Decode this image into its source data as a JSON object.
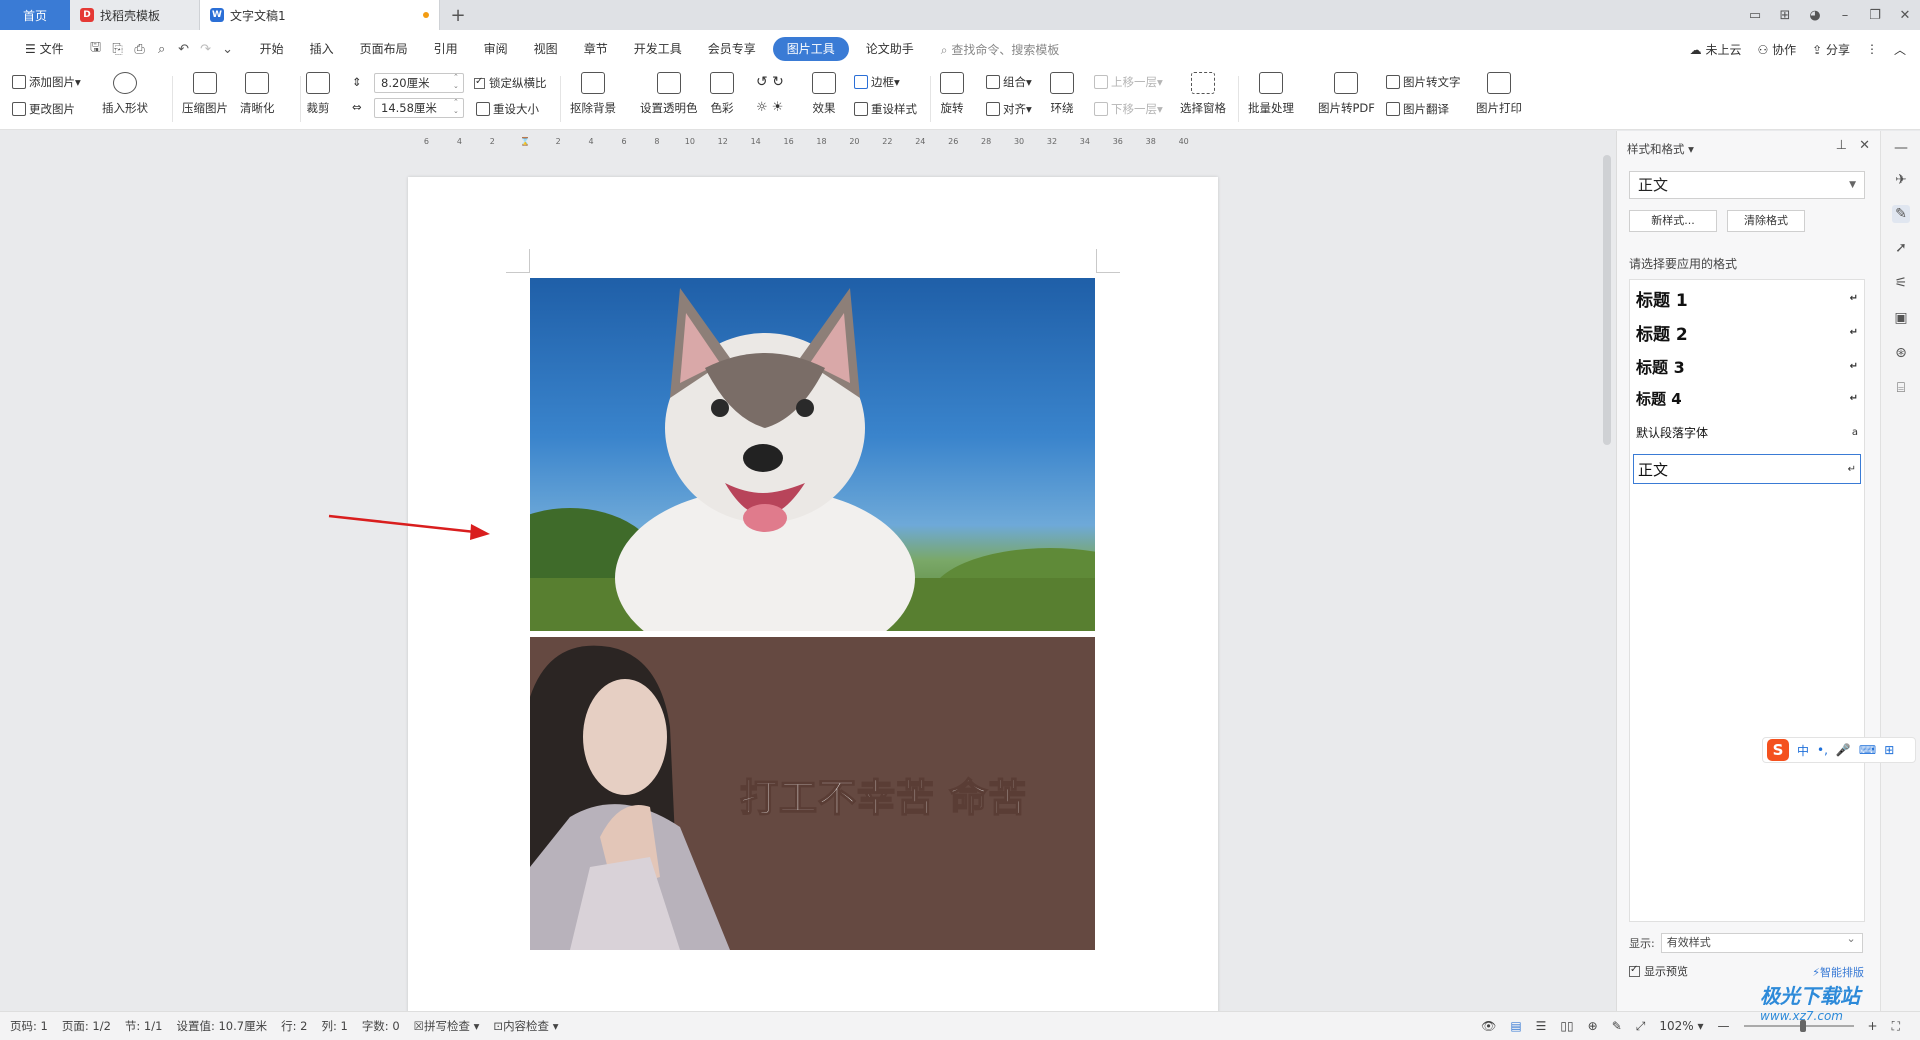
{
  "tabs": {
    "home": "首页",
    "template": "找稻壳模板",
    "doc": "文字文稿1",
    "add": "+"
  },
  "menu": {
    "file": "文件",
    "items": [
      "开始",
      "插入",
      "页面布局",
      "引用",
      "审阅",
      "视图",
      "章节",
      "开发工具",
      "会员专享"
    ],
    "active": "图片工具",
    "extra": "论文助手",
    "search": "查找命令、搜索模板",
    "right": {
      "cloud": "未上云",
      "collab": "协作",
      "share": "分享"
    }
  },
  "ribbon": {
    "add_picture": "添加图片",
    "change_picture": "更改图片",
    "insert_shape": "插入形状",
    "compress": "压缩图片",
    "sharpen": "清晰化",
    "crop": "裁剪",
    "width": "8.20厘米",
    "height": "14.58厘米",
    "lock_ratio": "锁定纵横比",
    "reset_size": "重设大小",
    "remove_bg": "抠除背景",
    "set_transparent": "设置透明色",
    "color": "色彩",
    "effects": "效果",
    "border": "边框",
    "reset_style": "重设样式",
    "rotate": "旋转",
    "group": "组合",
    "align": "对齐",
    "wrap": "环绕",
    "bring_forward": "上移一层",
    "send_backward": "下移一层",
    "selection_pane": "选择窗格",
    "batch": "批量处理",
    "to_pdf": "图片转PDF",
    "to_text": "图片转文字",
    "translate": "图片翻译",
    "print": "图片打印"
  },
  "ruler": [
    "6",
    "4",
    "2",
    "",
    "2",
    "4",
    "6",
    "8",
    "10",
    "12",
    "14",
    "16",
    "18",
    "20",
    "22",
    "24",
    "26",
    "28",
    "30",
    "32",
    "34",
    "36",
    "38",
    "40"
  ],
  "document": {
    "image2_caption": "打工不幸苦 命苦"
  },
  "panel": {
    "title": "样式和格式",
    "current_style": "正文",
    "new_style": "新样式...",
    "clear_format": "清除格式",
    "pick_label": "请选择要应用的格式",
    "styles": [
      "标题  1",
      "标题  2",
      "标题  3",
      "标题  4",
      "默认段落字体",
      "正文"
    ],
    "show_label": "显示:",
    "show_value": "有效样式",
    "show_preview": "显示预览",
    "smart_layout": "智能排版"
  },
  "ime": {
    "logo": "S",
    "lang": "中",
    "punct": "•,"
  },
  "status": {
    "page_code": "页码: 1",
    "page": "页面: 1/2",
    "section": "节: 1/1",
    "setting": "设置值: 10.7厘米",
    "row": "行: 2",
    "col": "列: 1",
    "words": "字数: 0",
    "spell": "拼写检查",
    "content_check": "内容检查",
    "zoom": "102%"
  },
  "watermark": {
    "main": "极光下载站",
    "sub": "www.xz7.com"
  },
  "colors": {
    "accent": "#3a7bd5",
    "arrow": "#d91e1e"
  }
}
